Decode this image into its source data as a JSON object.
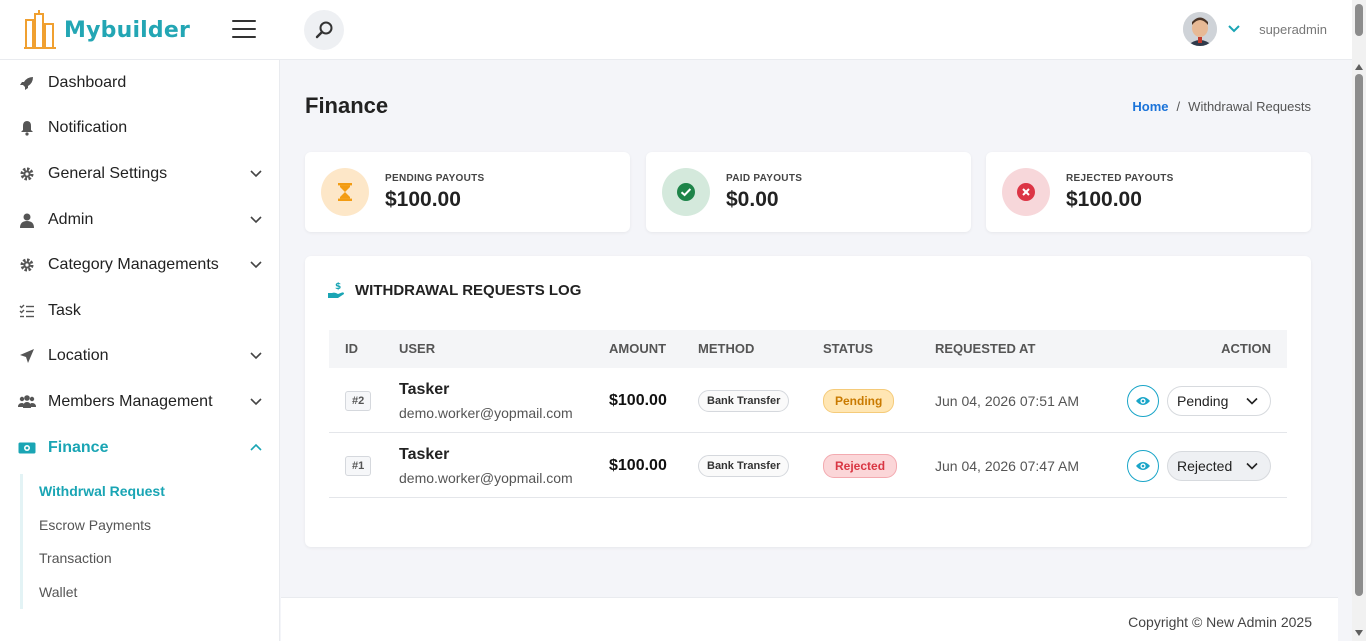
{
  "app": {
    "logo_text": "Mybuilder",
    "username": "superadmin"
  },
  "sidebar": {
    "items": [
      {
        "label": "Dashboard",
        "icon": "rocket-icon"
      },
      {
        "label": "Notification",
        "icon": "bell-icon"
      },
      {
        "label": "General Settings",
        "icon": "gear-icon"
      },
      {
        "label": "Admin",
        "icon": "user-icon"
      },
      {
        "label": "Category Managements",
        "icon": "gear-icon"
      },
      {
        "label": "Task",
        "icon": "list-icon"
      },
      {
        "label": "Location",
        "icon": "location-arrow-icon"
      },
      {
        "label": "Members Management",
        "icon": "users-icon"
      },
      {
        "label": "Finance",
        "icon": "money-icon"
      }
    ],
    "finance_sub": [
      {
        "label": "Withdrwal Request"
      },
      {
        "label": "Escrow Payments"
      },
      {
        "label": "Transaction"
      },
      {
        "label": "Wallet"
      }
    ]
  },
  "page": {
    "title": "Finance",
    "breadcrumb_home": "Home",
    "breadcrumb_sep": "/",
    "breadcrumb_current": "Withdrawal Requests"
  },
  "stats": {
    "pending": {
      "label": "PENDING PAYOUTS",
      "value": "$100.00",
      "color": "#f39c12"
    },
    "paid": {
      "label": "PAID PAYOUTS",
      "value": "$0.00",
      "color": "#1e8449"
    },
    "rejected": {
      "label": "REJECTED PAYOUTS",
      "value": "$100.00",
      "color": "#dc3545"
    }
  },
  "log": {
    "title": "WITHDRAWAL REQUESTS LOG",
    "columns": [
      "ID",
      "USER",
      "AMOUNT",
      "METHOD",
      "STATUS",
      "REQUESTED AT",
      "ACTION"
    ],
    "rows": [
      {
        "id": "#2",
        "name": "Tasker",
        "email": "demo.worker@yopmail.com",
        "amount": "$100.00",
        "method": "Bank Transfer",
        "status": "Pending",
        "requested_at": "Jun 04, 2026 07:51 AM",
        "action": "Pending"
      },
      {
        "id": "#1",
        "name": "Tasker",
        "email": "demo.worker@yopmail.com",
        "amount": "$100.00",
        "method": "Bank Transfer",
        "status": "Rejected",
        "requested_at": "Jun 04, 2026 07:47 AM",
        "action": "Rejected"
      }
    ]
  },
  "footer": {
    "copyright": "Copyright © New Admin 2025"
  },
  "colors": {
    "accent": "#1aa5b4",
    "link": "#1a73d9"
  }
}
